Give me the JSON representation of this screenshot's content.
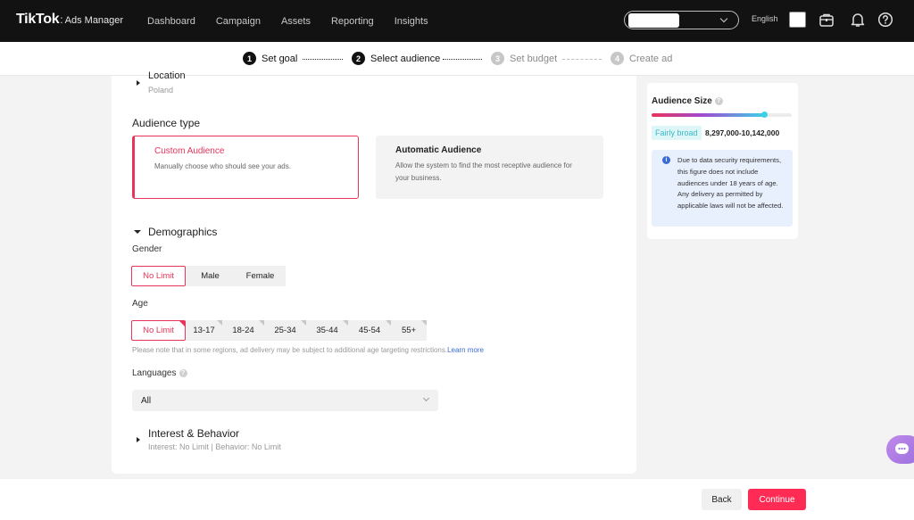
{
  "header": {
    "brand": "TikTok",
    "brand_separator": ":",
    "brand_sub": "Ads Manager",
    "nav": [
      "Dashboard",
      "Campaign",
      "Assets",
      "Reporting",
      "Insights"
    ],
    "language": "English",
    "icons": [
      "briefcase-icon",
      "bell-icon",
      "help-icon"
    ]
  },
  "stepper": {
    "steps": [
      {
        "num": "1",
        "label": "Set goal",
        "state": "done"
      },
      {
        "num": "2",
        "label": "Select audience",
        "state": "active"
      },
      {
        "num": "3",
        "label": "Set budget",
        "state": "upcoming"
      },
      {
        "num": "4",
        "label": "Create ad",
        "state": "upcoming"
      }
    ]
  },
  "location": {
    "title": "Location",
    "value": "Poland"
  },
  "audience_type": {
    "title": "Audience type",
    "custom": {
      "title": "Custom Audience",
      "desc": "Manually choose who should see your ads."
    },
    "automatic": {
      "title": "Automatic Audience",
      "desc": "Allow the system to find the most receptive audience for your business."
    }
  },
  "demographics": {
    "title": "Demographics",
    "gender": {
      "label": "Gender",
      "options": [
        "No Limit",
        "Male",
        "Female"
      ],
      "selected": "No Limit"
    },
    "age": {
      "label": "Age",
      "options": [
        "No Limit",
        "13-17",
        "18-24",
        "25-34",
        "35-44",
        "45-54",
        "55+"
      ],
      "selected": "No Limit"
    },
    "age_note": "Please note that in some regions, ad delivery may be subject to additional age targeting restrictions.",
    "learn_more": "Learn more",
    "languages": {
      "label": "Languages",
      "value": "All"
    }
  },
  "interest": {
    "title": "Interest & Behavior",
    "summary": "Interest: No Limit | Behavior: No Limit"
  },
  "audience_size": {
    "title": "Audience Size",
    "level": 0.8,
    "badge": "Fairly broad",
    "range": "8,297,000-10,142,000",
    "info": "Due to data security requirements, this figure does not include audiences under 18 years of age. Any delivery as permitted by applicable laws will not be affected."
  },
  "footer": {
    "back": "Back",
    "continue": "Continue"
  },
  "colors": {
    "accent": "#fe2c55",
    "selected_border": "#e8345a",
    "topbar": "#121212",
    "info_bg": "#e8effd"
  }
}
